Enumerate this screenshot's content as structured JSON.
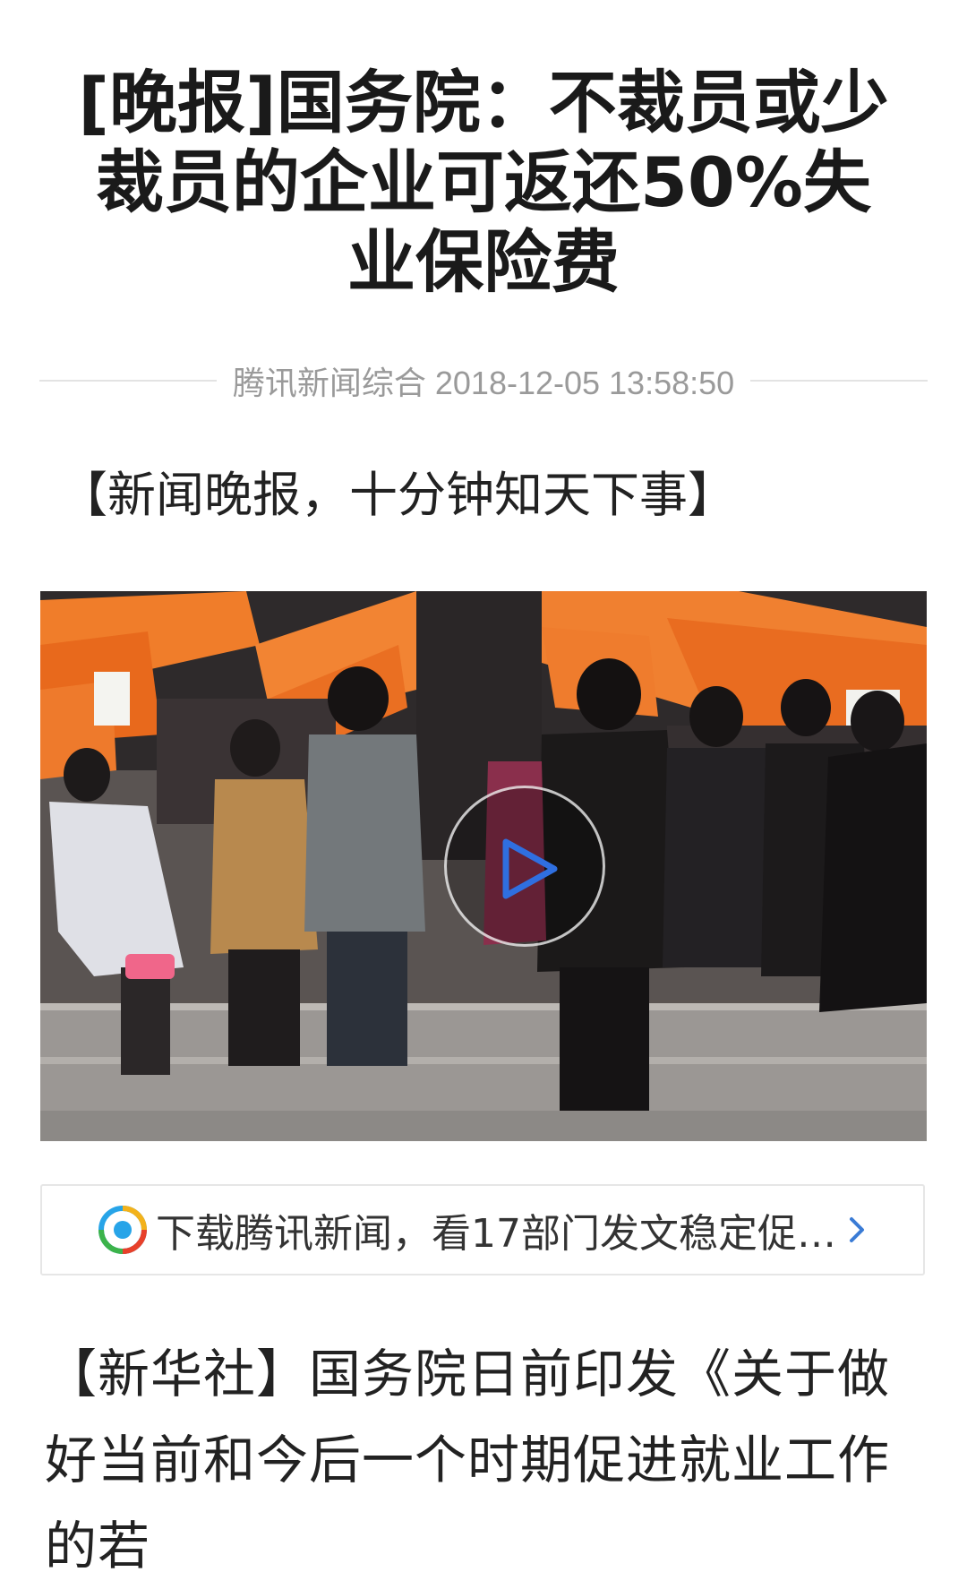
{
  "article": {
    "title": "[晚报]国务院：不裁员或少裁员的企业可返还50%失业保险费",
    "source": "腾讯新闻综合",
    "datetime": "2018-12-05 13:58:50",
    "lead": "【新闻晚报，十分钟知天下事】",
    "body": "【新华社】国务院日前印发《关于做好当前和今后一个时期促进就业工作的若"
  },
  "video": {
    "play_icon": "play-icon",
    "accent_color": "#2f6fe0"
  },
  "promo": {
    "logo_icon": "tencent-news-logo-icon",
    "text": "下载腾讯新闻，看17部门发文稳定促…",
    "chevron_icon": "chevron-right-icon",
    "chevron_color": "#3a7bd5"
  }
}
